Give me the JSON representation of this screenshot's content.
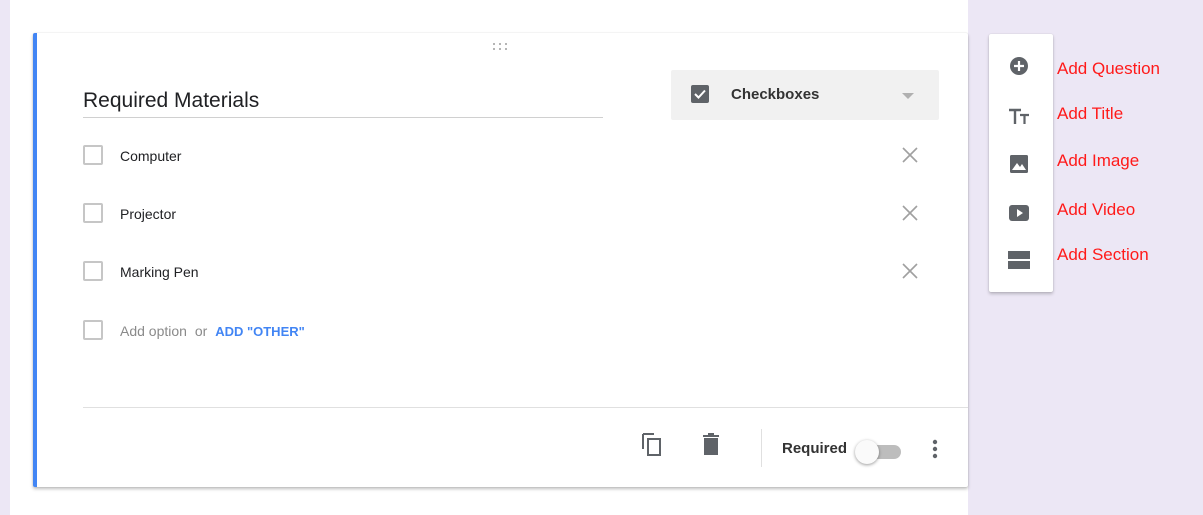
{
  "question": {
    "title": "Required Materials",
    "type_label": "Checkboxes",
    "options": [
      {
        "label": "Computer"
      },
      {
        "label": "Projector"
      },
      {
        "label": "Marking Pen"
      }
    ],
    "add_option_text": "Add option",
    "or_text": "or",
    "add_other_text": "ADD \"OTHER\"",
    "required_label": "Required",
    "required_enabled": false
  },
  "side_toolbar": {
    "items": [
      {
        "icon": "add-circle-icon",
        "label": "Add Question"
      },
      {
        "icon": "text-title-icon",
        "label": "Add Title"
      },
      {
        "icon": "image-icon",
        "label": "Add Image"
      },
      {
        "icon": "video-icon",
        "label": "Add Video"
      },
      {
        "icon": "section-icon",
        "label": "Add Section"
      }
    ]
  },
  "colors": {
    "accent": "#4285f4",
    "annotation": "#ff1a1a",
    "background": "#ece7f5"
  }
}
